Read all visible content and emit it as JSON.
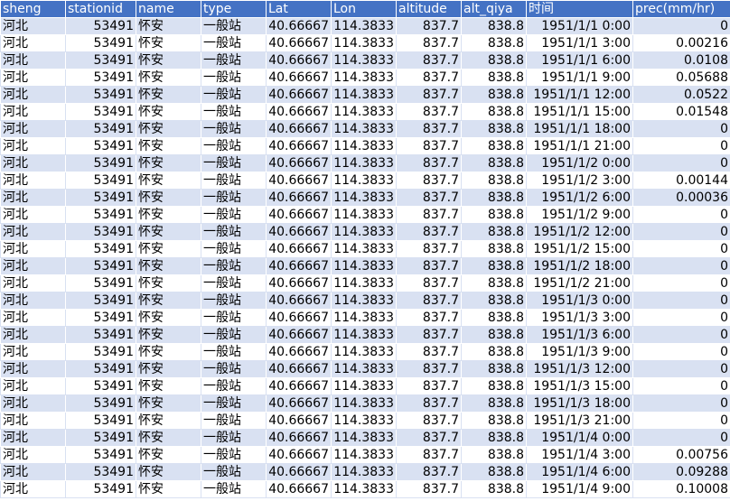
{
  "columns": [
    "sheng",
    "stationid",
    "name",
    "type",
    "Lat",
    "Lon",
    "altitude",
    "alt_qiya",
    "时间",
    "prec(mm/hr)"
  ],
  "rows": [
    [
      "河北",
      "53491",
      "怀安",
      "一般站",
      "40.66667",
      "114.3833",
      "837.7",
      "838.8",
      "1951/1/1 0:00",
      "0"
    ],
    [
      "河北",
      "53491",
      "怀安",
      "一般站",
      "40.66667",
      "114.3833",
      "837.7",
      "838.8",
      "1951/1/1 3:00",
      "0.00216"
    ],
    [
      "河北",
      "53491",
      "怀安",
      "一般站",
      "40.66667",
      "114.3833",
      "837.7",
      "838.8",
      "1951/1/1 6:00",
      "0.0108"
    ],
    [
      "河北",
      "53491",
      "怀安",
      "一般站",
      "40.66667",
      "114.3833",
      "837.7",
      "838.8",
      "1951/1/1 9:00",
      "0.05688"
    ],
    [
      "河北",
      "53491",
      "怀安",
      "一般站",
      "40.66667",
      "114.3833",
      "837.7",
      "838.8",
      "1951/1/1 12:00",
      "0.0522"
    ],
    [
      "河北",
      "53491",
      "怀安",
      "一般站",
      "40.66667",
      "114.3833",
      "837.7",
      "838.8",
      "1951/1/1 15:00",
      "0.01548"
    ],
    [
      "河北",
      "53491",
      "怀安",
      "一般站",
      "40.66667",
      "114.3833",
      "837.7",
      "838.8",
      "1951/1/1 18:00",
      "0"
    ],
    [
      "河北",
      "53491",
      "怀安",
      "一般站",
      "40.66667",
      "114.3833",
      "837.7",
      "838.8",
      "1951/1/1 21:00",
      "0"
    ],
    [
      "河北",
      "53491",
      "怀安",
      "一般站",
      "40.66667",
      "114.3833",
      "837.7",
      "838.8",
      "1951/1/2 0:00",
      "0"
    ],
    [
      "河北",
      "53491",
      "怀安",
      "一般站",
      "40.66667",
      "114.3833",
      "837.7",
      "838.8",
      "1951/1/2 3:00",
      "0.00144"
    ],
    [
      "河北",
      "53491",
      "怀安",
      "一般站",
      "40.66667",
      "114.3833",
      "837.7",
      "838.8",
      "1951/1/2 6:00",
      "0.00036"
    ],
    [
      "河北",
      "53491",
      "怀安",
      "一般站",
      "40.66667",
      "114.3833",
      "837.7",
      "838.8",
      "1951/1/2 9:00",
      "0"
    ],
    [
      "河北",
      "53491",
      "怀安",
      "一般站",
      "40.66667",
      "114.3833",
      "837.7",
      "838.8",
      "1951/1/2 12:00",
      "0"
    ],
    [
      "河北",
      "53491",
      "怀安",
      "一般站",
      "40.66667",
      "114.3833",
      "837.7",
      "838.8",
      "1951/1/2 15:00",
      "0"
    ],
    [
      "河北",
      "53491",
      "怀安",
      "一般站",
      "40.66667",
      "114.3833",
      "837.7",
      "838.8",
      "1951/1/2 18:00",
      "0"
    ],
    [
      "河北",
      "53491",
      "怀安",
      "一般站",
      "40.66667",
      "114.3833",
      "837.7",
      "838.8",
      "1951/1/2 21:00",
      "0"
    ],
    [
      "河北",
      "53491",
      "怀安",
      "一般站",
      "40.66667",
      "114.3833",
      "837.7",
      "838.8",
      "1951/1/3 0:00",
      "0"
    ],
    [
      "河北",
      "53491",
      "怀安",
      "一般站",
      "40.66667",
      "114.3833",
      "837.7",
      "838.8",
      "1951/1/3 3:00",
      "0"
    ],
    [
      "河北",
      "53491",
      "怀安",
      "一般站",
      "40.66667",
      "114.3833",
      "837.7",
      "838.8",
      "1951/1/3 6:00",
      "0"
    ],
    [
      "河北",
      "53491",
      "怀安",
      "一般站",
      "40.66667",
      "114.3833",
      "837.7",
      "838.8",
      "1951/1/3 9:00",
      "0"
    ],
    [
      "河北",
      "53491",
      "怀安",
      "一般站",
      "40.66667",
      "114.3833",
      "837.7",
      "838.8",
      "1951/1/3 12:00",
      "0"
    ],
    [
      "河北",
      "53491",
      "怀安",
      "一般站",
      "40.66667",
      "114.3833",
      "837.7",
      "838.8",
      "1951/1/3 15:00",
      "0"
    ],
    [
      "河北",
      "53491",
      "怀安",
      "一般站",
      "40.66667",
      "114.3833",
      "837.7",
      "838.8",
      "1951/1/3 18:00",
      "0"
    ],
    [
      "河北",
      "53491",
      "怀安",
      "一般站",
      "40.66667",
      "114.3833",
      "837.7",
      "838.8",
      "1951/1/3 21:00",
      "0"
    ],
    [
      "河北",
      "53491",
      "怀安",
      "一般站",
      "40.66667",
      "114.3833",
      "837.7",
      "838.8",
      "1951/1/4 0:00",
      "0"
    ],
    [
      "河北",
      "53491",
      "怀安",
      "一般站",
      "40.66667",
      "114.3833",
      "837.7",
      "838.8",
      "1951/1/4 3:00",
      "0.00756"
    ],
    [
      "河北",
      "53491",
      "怀安",
      "一般站",
      "40.66667",
      "114.3833",
      "837.7",
      "838.8",
      "1951/1/4 6:00",
      "0.09288"
    ],
    [
      "河北",
      "53491",
      "怀安",
      "一般站",
      "40.66667",
      "114.3833",
      "837.7",
      "838.8",
      "1951/1/4 9:00",
      "0.10008"
    ]
  ],
  "colors": {
    "header": "#4472c4",
    "band": "#d9e1f2"
  }
}
